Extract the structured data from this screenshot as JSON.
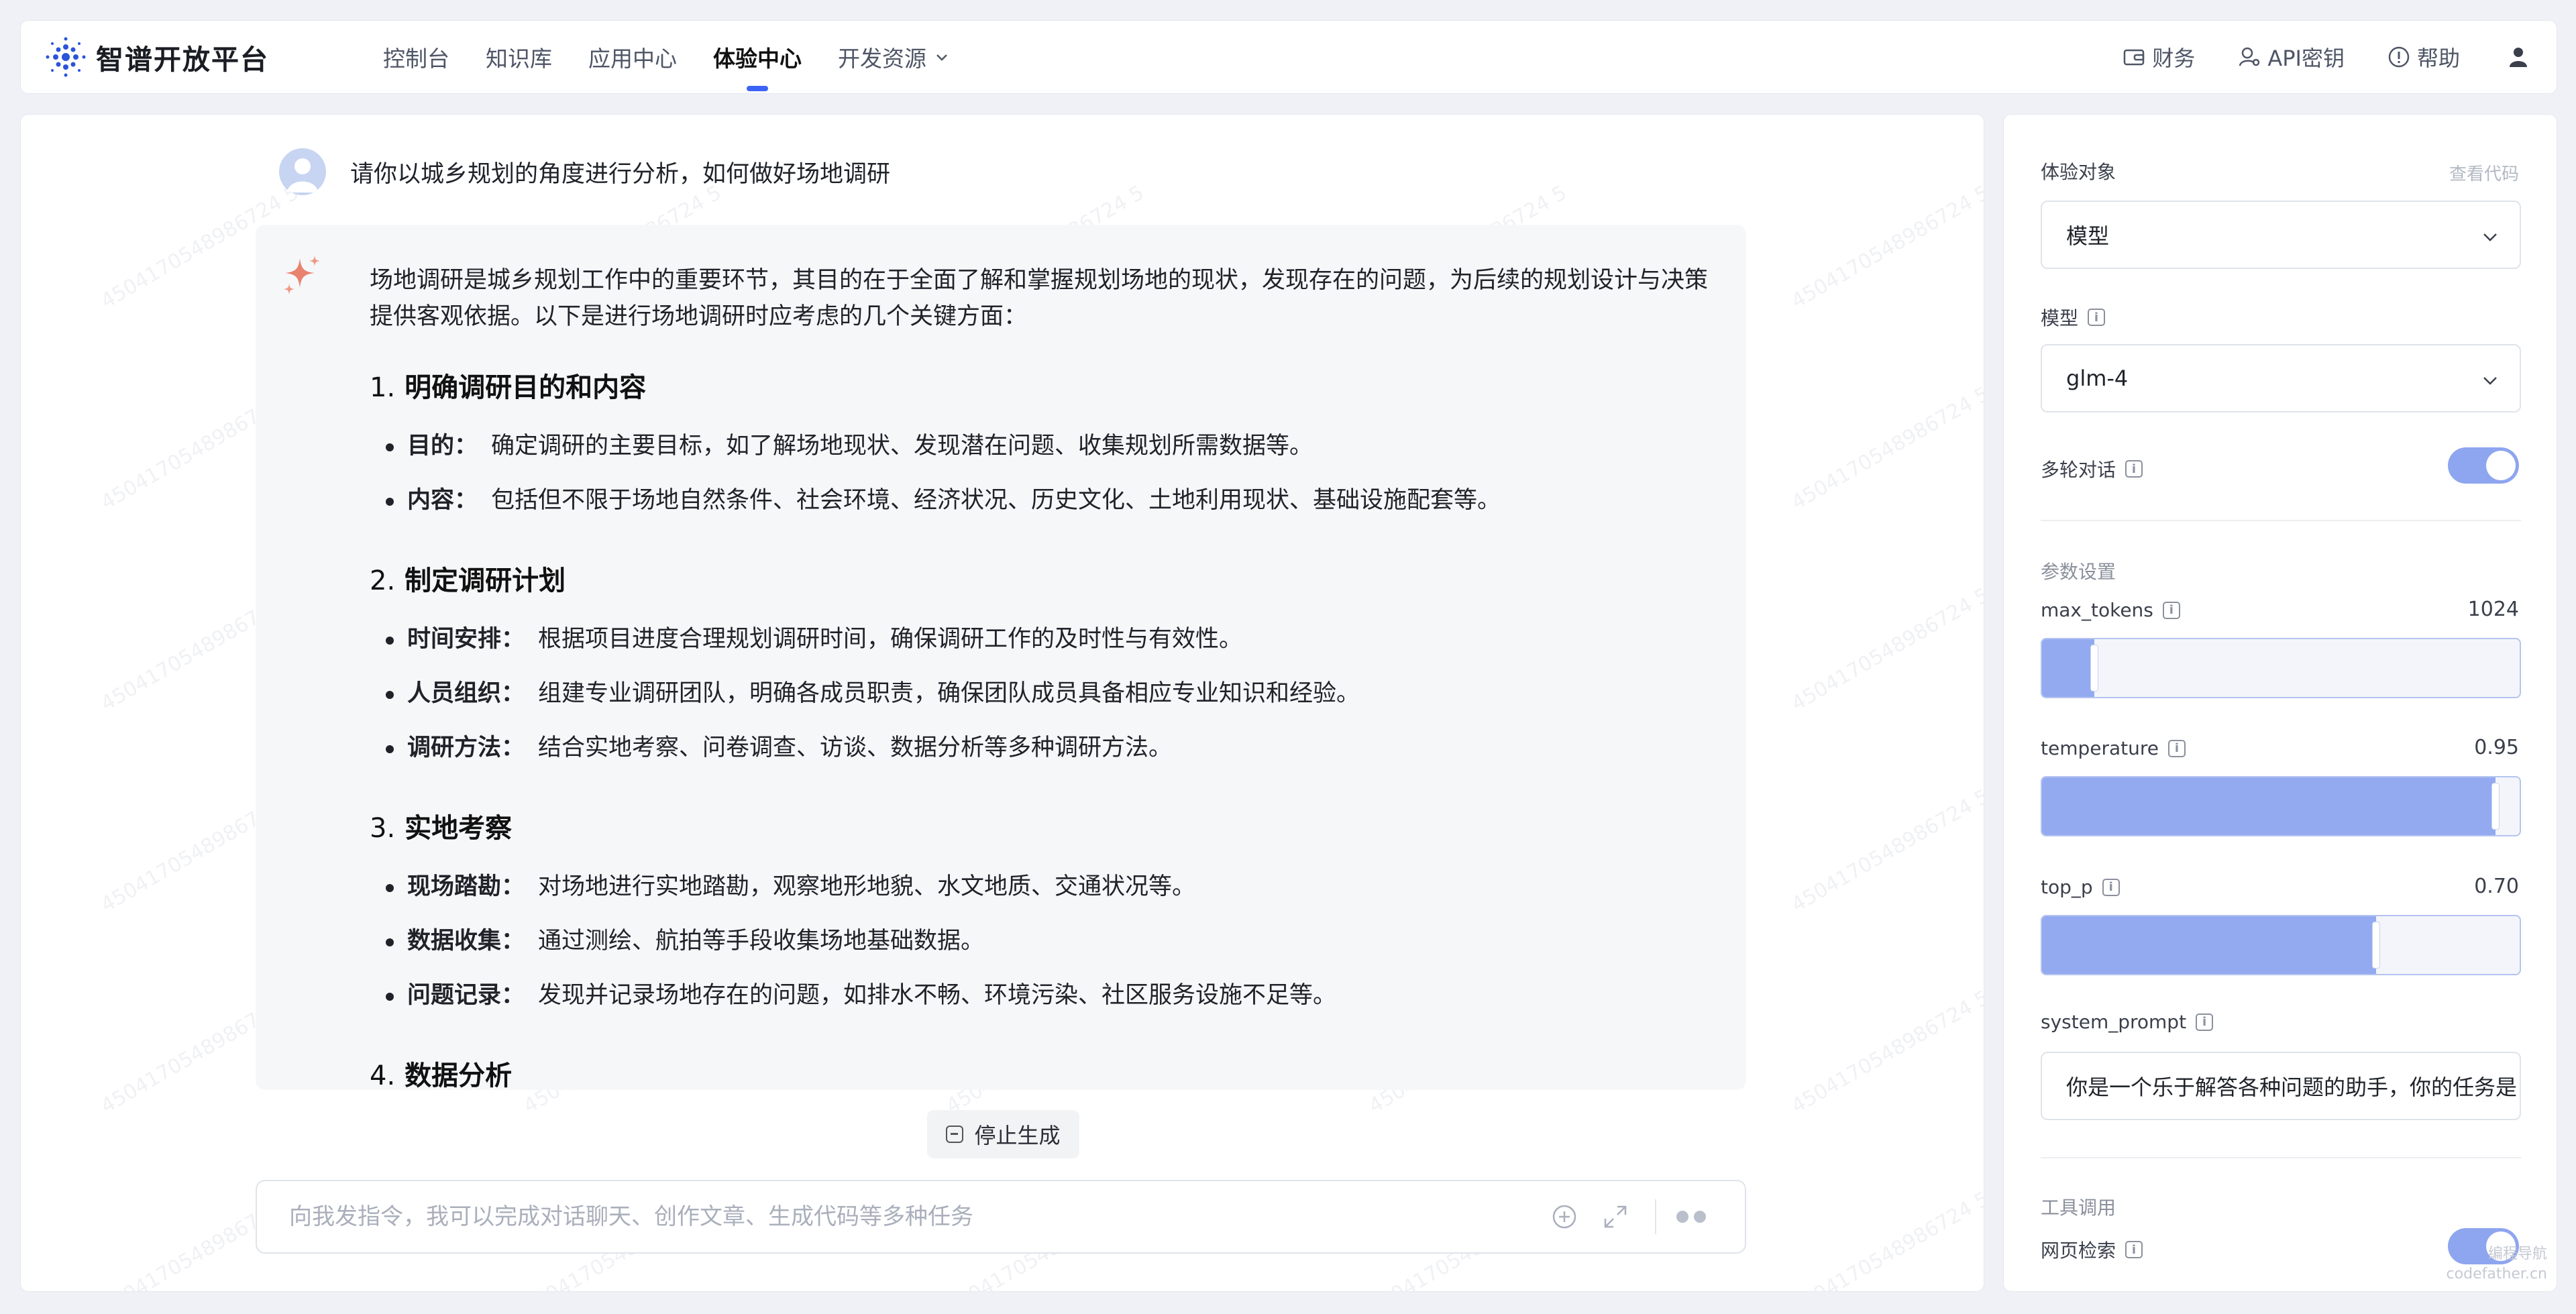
{
  "brand": {
    "name": "智谱开放平台"
  },
  "nav": [
    {
      "label": "控制台",
      "active": false
    },
    {
      "label": "知识库",
      "active": false
    },
    {
      "label": "应用中心",
      "active": false
    },
    {
      "label": "体验中心",
      "active": true
    },
    {
      "label": "开发资源",
      "active": false,
      "dropdown": true
    }
  ],
  "top_links": {
    "finance": "财务",
    "api_key": "API密钥",
    "help": "帮助"
  },
  "watermark_text": "4504170548986724 5",
  "chat": {
    "user_message": "请你以城乡规划的角度进行分析，如何做好场地调研",
    "answer": {
      "intro": "场地调研是城乡规划工作中的重要环节，其目的在于全面了解和掌握规划场地的现状，发现存在的问题，为后续的规划设计与决策提供客观依据。以下是进行场地调研时应考虑的几个关键方面：",
      "sections": [
        {
          "num": "1.",
          "title": "明确调研目的和内容",
          "items": [
            {
              "k": "目的：",
              "v": "确定调研的主要目标，如了解场地现状、发现潜在问题、收集规划所需数据等。"
            },
            {
              "k": "内容：",
              "v": "包括但不限于场地自然条件、社会环境、经济状况、历史文化、土地利用现状、基础设施配套等。"
            }
          ]
        },
        {
          "num": "2.",
          "title": "制定调研计划",
          "items": [
            {
              "k": "时间安排：",
              "v": "根据项目进度合理规划调研时间，确保调研工作的及时性与有效性。"
            },
            {
              "k": "人员组织：",
              "v": "组建专业调研团队，明确各成员职责，确保团队成员具备相应专业知识和经验。"
            },
            {
              "k": "调研方法：",
              "v": "结合实地考察、问卷调查、访谈、数据分析等多种调研方法。"
            }
          ]
        },
        {
          "num": "3.",
          "title": "实地考察",
          "items": [
            {
              "k": "现场踏勘：",
              "v": "对场地进行实地踏勘，观察地形地貌、水文地质、交通状况等。"
            },
            {
              "k": "数据收集：",
              "v": "通过测绘、航拍等手段收集场地基础数据。"
            },
            {
              "k": "问题记录：",
              "v": "发现并记录场地存在的问题，如排水不畅、环境污染、社区服务设施不足等。"
            }
          ]
        },
        {
          "num": "4.",
          "title": "数据分析",
          "items": []
        }
      ]
    },
    "stop_label": "停止生成",
    "input_placeholder": "向我发指令，我可以完成对话聊天、创作文章、生成代码等多种任务"
  },
  "settings": {
    "target_label": "体验对象",
    "view_code": "查看代码",
    "target_value": "模型",
    "model_label": "模型",
    "model_value": "glm-4",
    "multi_turn_label": "多轮对话",
    "multi_turn_on": true,
    "params_label": "参数设置",
    "max_tokens": {
      "label": "max_tokens",
      "value": "1024",
      "fraction": 0.11
    },
    "temperature": {
      "label": "temperature",
      "value": "0.95",
      "fraction": 0.95
    },
    "top_p": {
      "label": "top_p",
      "value": "0.70",
      "fraction": 0.7
    },
    "system_prompt_label": "system_prompt",
    "system_prompt_value": "你是一个乐于解答各种问题的助手，你的任务是",
    "tools_label": "工具调用",
    "web_search_label": "网页检索",
    "web_search_on": true
  },
  "corner_watermark": [
    "编程导航",
    "codefather.cn"
  ],
  "colors": {
    "accent": "#3b63f6",
    "toggle": "#8ea5ef",
    "slider_fill": "#93aaf0"
  }
}
